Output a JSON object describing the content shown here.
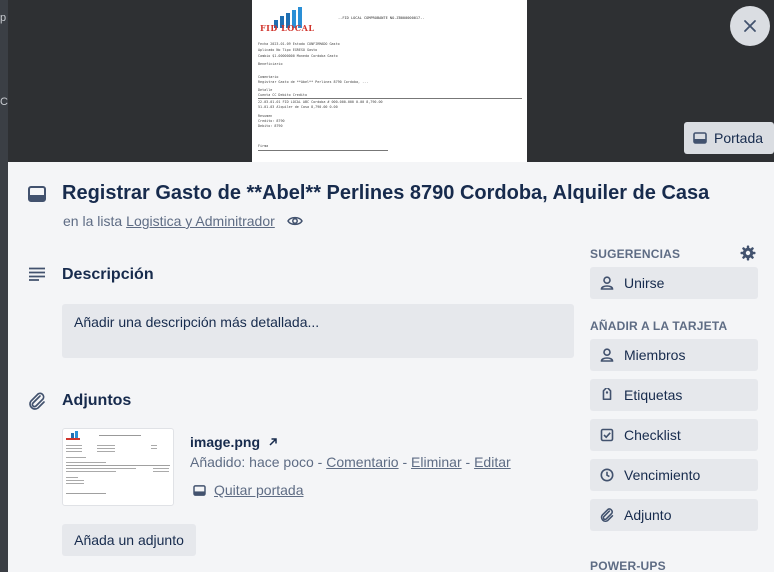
{
  "backdrop": {
    "left_chars": [
      "p",
      "C"
    ]
  },
  "cover": {
    "logo_text": "FID LOCAL",
    "doc_header": "--FID LOCAL COMPROBANTE NO-ZB000000017--",
    "doc_lines": [
      "Fecha       2023-01-09          Estado    CONFIRMADO          Gasto",
      "Aplicado    No                  Tipo      EGRESO              Gasto",
      "Cambio      $1.00000000         Moneda    Cordoba             Gasto",
      "Beneficiario",
      "Comentario",
      "Registrar Gasto de **Abel** Perlines 8790 Cordoba, ...",
      "Detalle",
      "Cuenta                               CC                 Debito       Credito",
      "22-03-01-01 FID LOCAL ABC Cordoba # 000-000-000              0.00      8,790.00",
      "51-01-03 Alquiler de Casa                              8,790.00          0.00",
      "Resumen",
      "Credito:    8790",
      "Debito:     8790",
      "Firma"
    ],
    "portada_label": "Portada"
  },
  "card": {
    "title": "Registrar Gasto de **Abel** Perlines 8790 Cordoba, Alquiler de Casa",
    "list_prefix": "en la lista",
    "list_name": "Logistica y Adminitrador"
  },
  "description": {
    "heading": "Descripción",
    "placeholder": "Añadir una descripción más detallada..."
  },
  "attachments": {
    "heading": "Adjuntos",
    "items": [
      {
        "name": "image.png",
        "added_prefix": "Añadido: hace poco",
        "sep": " - ",
        "actions": [
          "Comentario",
          "Eliminar",
          "Editar"
        ],
        "remove_cover": "Quitar portada"
      }
    ],
    "add_button": "Añada un adjunto"
  },
  "sidebar": {
    "suggestions_heading": "SUGERENCIAS",
    "join_label": "Unirse",
    "add_heading": "AÑADIR A LA TARJETA",
    "add_items": [
      {
        "label": "Miembros",
        "icon": "person-icon"
      },
      {
        "label": "Etiquetas",
        "icon": "tag-icon"
      },
      {
        "label": "Checklist",
        "icon": "checklist-icon"
      },
      {
        "label": "Vencimiento",
        "icon": "clock-icon"
      },
      {
        "label": "Adjunto",
        "icon": "paperclip-icon"
      }
    ],
    "powerups_heading": "POWER-UPS"
  }
}
